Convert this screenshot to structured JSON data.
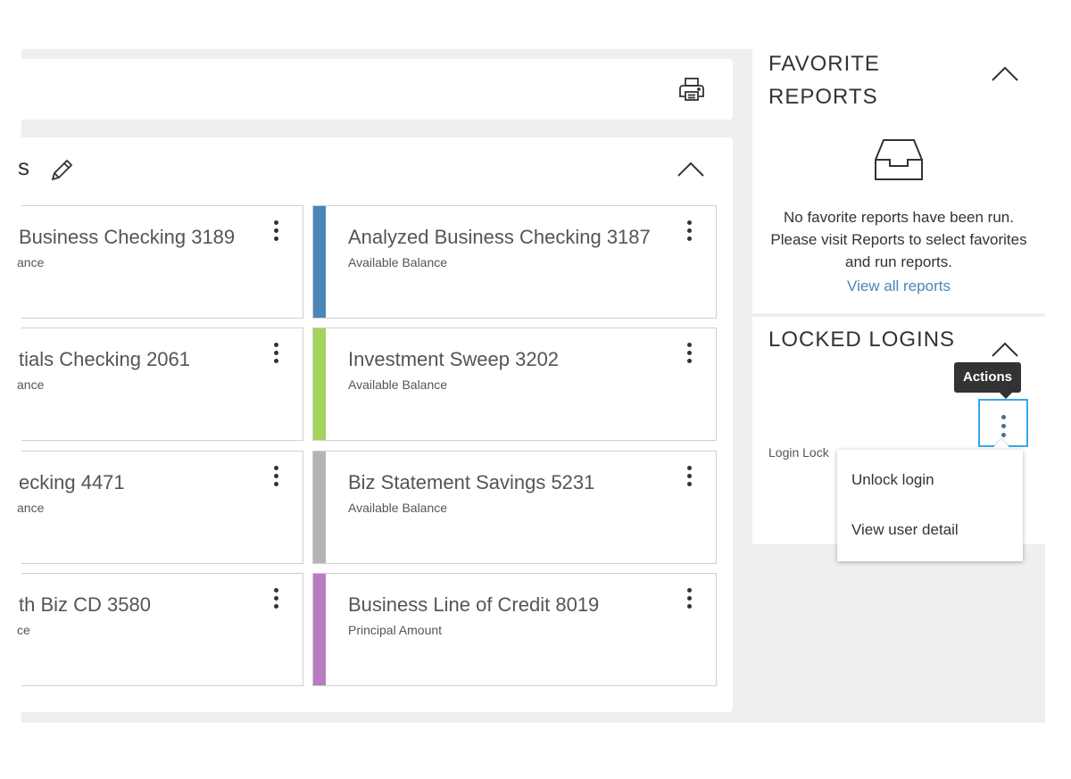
{
  "topbar": {
    "print_icon": "printer-icon"
  },
  "accounts": {
    "title_fragment": "s",
    "edit_icon": "pencil-icon",
    "collapse_icon": "chevron-up-icon",
    "left_cards": [
      {
        "name": "Business Checking 3189",
        "sub": "ance"
      },
      {
        "name": "tials Checking 2061",
        "sub": "ance"
      },
      {
        "name": "ecking 4471",
        "sub": "ance"
      },
      {
        "name": "th Biz CD 3580",
        "sub": "ce"
      }
    ],
    "right_cards": [
      {
        "name": "Analyzed Business Checking 3187",
        "sub": "Available Balance",
        "color": "#4a86b8"
      },
      {
        "name": "Investment Sweep 3202",
        "sub": "Available Balance",
        "color": "#a2d45e"
      },
      {
        "name": "Biz Statement Savings 5231",
        "sub": "Available Balance",
        "color": "#b3b3b3"
      },
      {
        "name": "Business Line of Credit 8019",
        "sub": "Principal Amount",
        "color": "#b87cc0"
      }
    ]
  },
  "favorite_reports": {
    "title": "FAVORITE REPORTS",
    "empty_message": "No favorite reports have been run. Please visit Reports to select favorites and run reports.",
    "view_all_label": "View all reports"
  },
  "locked_logins": {
    "title": "LOCKED LOGINS",
    "row_text": "Login Lock",
    "tooltip": "Actions",
    "menu": [
      "Unlock login",
      "View user detail"
    ]
  }
}
